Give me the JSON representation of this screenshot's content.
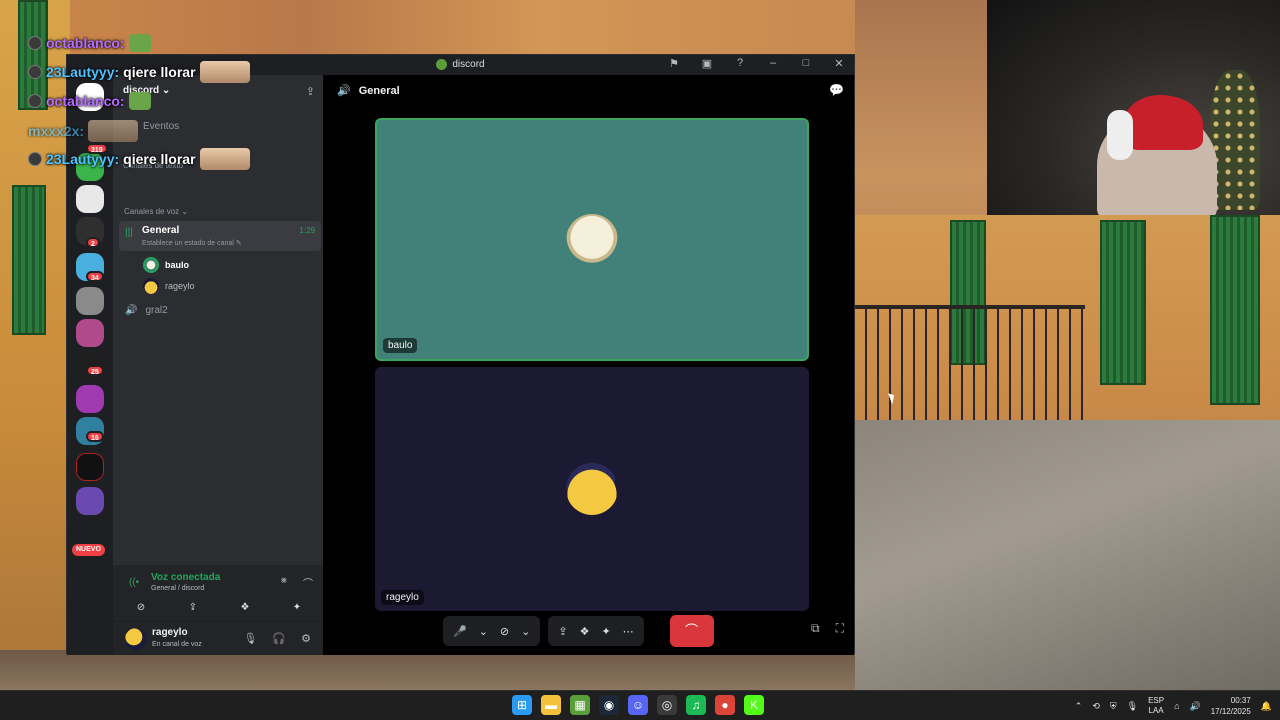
{
  "stream_chat": [
    {
      "user": "octablanco:",
      "message": "",
      "name_color": "#b56bff"
    },
    {
      "user": "23Lautyyy:",
      "message": "qiere llorar",
      "name_color": "#4fc3ff"
    },
    {
      "user": "octablanco:",
      "message": "",
      "name_color": "#b56bff"
    },
    {
      "user": "mxxx2x:",
      "message": "",
      "name_color": "#4fc3ff"
    },
    {
      "user": "23Lautyyy:",
      "message": "qiere llorar",
      "name_color": "#4fc3ff"
    }
  ],
  "window": {
    "title": "discord",
    "icons": [
      "flag-icon",
      "screen-icon",
      "help-icon",
      "minimize-icon",
      "maximize-icon",
      "close-icon"
    ],
    "glyphs": {
      "flag": "⚑",
      "screen": "▣",
      "help": "?",
      "minimize": "–",
      "maximize": "□",
      "close": "✕"
    }
  },
  "servers": {
    "badges": {
      "first": "319",
      "second": "2",
      "third": "34",
      "fourth": "25",
      "fifth": "16"
    },
    "new_label": "NUEVO",
    "colors": [
      "#ffffff",
      "#3bb54a",
      "#e8e8e8",
      "#2f2f2f",
      "#4ab0e0",
      "#8a8a8a",
      "#b04a8a",
      "#1e1e1e",
      "#a03ab0",
      "#3080a0",
      "#111111",
      "#6a4ab0"
    ]
  },
  "sidebar": {
    "server_name": "discord",
    "server_chevron": "⌄",
    "events_label": "Eventos",
    "text_category": "Canales de texto",
    "voice_category": "Canales de voz",
    "voice_chevron": "⌄",
    "general": {
      "name": "General",
      "timer": "1:29",
      "status": "Establece un estado de canal ✎",
      "users": [
        {
          "name": "baulo",
          "color": "#ffffff"
        },
        {
          "name": "rageylo",
          "color": "#b5bac1"
        }
      ]
    },
    "gral2": {
      "name": "gral2"
    },
    "speaker_glyph": "🔊",
    "add_member_glyph": "⇪"
  },
  "voice_panel": {
    "title": "Voz conectada",
    "subtitle": "General / discord",
    "buttons": [
      "⊘",
      "⇪",
      "❖",
      "✦"
    ],
    "glyphs": {
      "signal": "((•",
      "noise": "⨳",
      "disconnect": "⌒"
    }
  },
  "user_panel": {
    "name": "rageylo",
    "status": "En canal de voz",
    "glyphs": {
      "mic": "🎙",
      "headset": "🎧",
      "settings": "⚙"
    }
  },
  "stage": {
    "header": "General",
    "header_icon": "🔊",
    "chat_glyph": "💬",
    "tiles": [
      {
        "name": "baulo"
      },
      {
        "name": "rageylo"
      }
    ],
    "call_bar": {
      "mic": "🎤",
      "mic_chevron": "⌄",
      "camera": "⊘",
      "camera_chevron": "⌄",
      "share": "⇪",
      "activities": "❖",
      "soundboard": "✦",
      "more": "⋯",
      "end": "⌒"
    },
    "right_icons": {
      "popout": "⧉",
      "fullscreen": "⛶"
    }
  },
  "taskbar": {
    "apps": [
      {
        "name": "windows-start-icon",
        "glyph": "⊞",
        "color": "#2b9af3"
      },
      {
        "name": "file-explorer-icon",
        "glyph": "▬",
        "color": "#f3c13a"
      },
      {
        "name": "minecraft-icon",
        "glyph": "▦",
        "color": "#5a9e3c"
      },
      {
        "name": "steam-icon",
        "glyph": "◉",
        "color": "#1b2838"
      },
      {
        "name": "discord-icon",
        "glyph": "☺",
        "color": "#5865f2"
      },
      {
        "name": "obs-icon",
        "glyph": "◎",
        "color": "#3a3a3a"
      },
      {
        "name": "spotify-icon",
        "glyph": "♫",
        "color": "#1db954"
      },
      {
        "name": "chrome-icon",
        "glyph": "●",
        "color": "#db4437"
      },
      {
        "name": "kick-icon",
        "glyph": "K",
        "color": "#53fc18"
      }
    ],
    "tray": {
      "chevron": "⌃",
      "lang_top": "ESP",
      "lang_bottom": "LAA",
      "time": "00:37",
      "date": "17/12/2025",
      "glyphs": {
        "network": "⟲",
        "shield": "⛨",
        "mic": "🎙",
        "volume": "🔊",
        "wifi": "⌂",
        "bell": "🔔"
      }
    }
  }
}
